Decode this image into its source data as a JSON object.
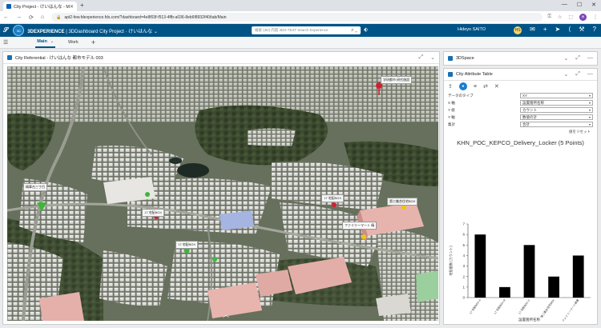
{
  "browser": {
    "tab_title": "City Project - けいはんな - Main",
    "url": "apt2-few.fdexperience.fds.com/?dashboard=4e8f03f-f513-4ffb-a036-8eb6f8932f40/tab/Main",
    "url_protocol_icon": "lock-icon"
  },
  "app": {
    "brand_bold": "3DEXPERIENCE",
    "brand_rest": " | 3DDashboard  City Project · けいはんな",
    "search_placeholder": "検索 (3D) 内容 3DS-TEST Search Experience",
    "user_name": "Hideyo SAITO",
    "avatar_initials": "HS",
    "colors": {
      "topbar": "#005386",
      "accent": "#1a7fd0"
    }
  },
  "dashboard": {
    "tabs": [
      {
        "label": "Main"
      },
      {
        "label": "Work"
      }
    ]
  },
  "widgets": {
    "map": {
      "title": "City Referential - けいはんな 都市モデル 003",
      "pins": [
        {
          "label": "学研都市 研究施設"
        },
        {
          "label": "精華台三丁目"
        },
        {
          "label": "17 宅配BOX"
        },
        {
          "label": "17 宅配BOX"
        },
        {
          "label": "ファミリーマート 精"
        },
        {
          "label": "17 宅配BOX"
        },
        {
          "label": "第二集合住宅BOX"
        }
      ]
    },
    "space3d": {
      "title": "3DSpace"
    },
    "attr_table": {
      "title": "City Attribute Table",
      "rows": [
        {
          "label": "データのタイプ",
          "value": "XY"
        },
        {
          "label": "X 軸",
          "value": "設置箇所名称"
        },
        {
          "label": "Y 値",
          "value": "カウント"
        },
        {
          "label": "Y 軸",
          "value": "数値の計"
        },
        {
          "label": "集計",
          "value": "合計"
        }
      ],
      "reset_label": "値をリセット"
    }
  },
  "chart_data": {
    "type": "bar",
    "title": "KHN_POC_KEPCO_Delivery_Locker (5 Points)",
    "xlabel": "設置箇所名称",
    "ylabel": "宅配個数 (カウント)",
    "categories": [
      "17 宅配BOX-A",
      "17 宅配BOX-B",
      "17 宅配BOX-C",
      "第二集合住宅BOX",
      "ファミリーマート精華"
    ],
    "values": [
      6,
      1,
      5,
      2,
      4
    ],
    "ylim": [
      0,
      7
    ],
    "yticks": [
      0,
      1,
      2,
      3,
      4,
      5,
      6,
      7
    ],
    "grid": false
  }
}
